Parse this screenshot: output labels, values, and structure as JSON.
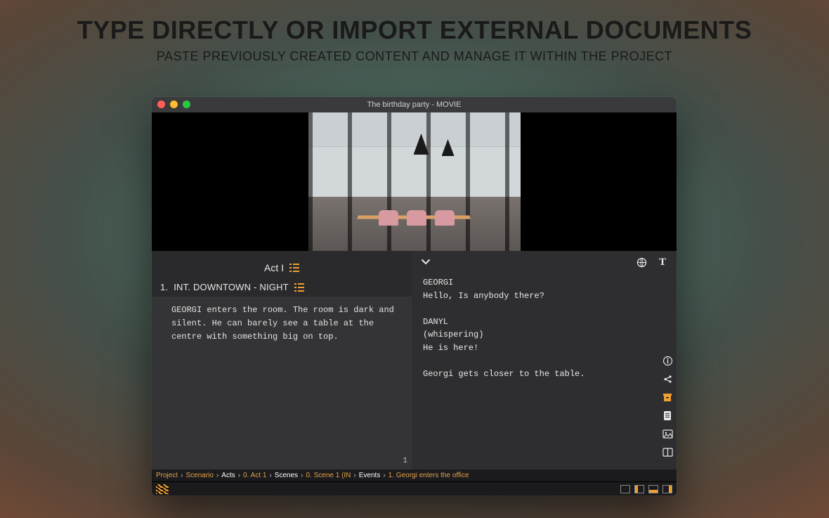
{
  "marketing": {
    "headline": "TYPE DIRECTLY OR IMPORT EXTERNAL DOCUMENTS",
    "subhead": "PASTE PREVIOUSLY CREATED CONTENT AND MANAGE IT WITHIN THE PROJECT"
  },
  "window": {
    "title": "The birthday party - MOVIE"
  },
  "left": {
    "act_label": "Act I",
    "scene_number": "1.",
    "scene_heading": "INT. DOWNTOWN - NIGHT",
    "action": "GEORGI enters the room. The room is dark and\nsilent. He can barely see a table at the\ncentre with something big on top.",
    "page_number": "1"
  },
  "right": {
    "script": "GEORGI\nHello, Is anybody there?\n\nDANYL\n(whispering)\nHe is here!\n\nGeorgi gets closer to the table."
  },
  "breadcrumbs": {
    "items": [
      {
        "label": "Project",
        "active": false
      },
      {
        "label": "Scenario",
        "active": false
      },
      {
        "label": "Acts",
        "active": true
      },
      {
        "label": "0. Act 1",
        "active": false
      },
      {
        "label": "Scenes",
        "active": true
      },
      {
        "label": "0. Scene 1 (IN",
        "active": false
      },
      {
        "label": "Events",
        "active": true
      },
      {
        "label": "1. Georgi enters the office",
        "active": false
      }
    ]
  }
}
